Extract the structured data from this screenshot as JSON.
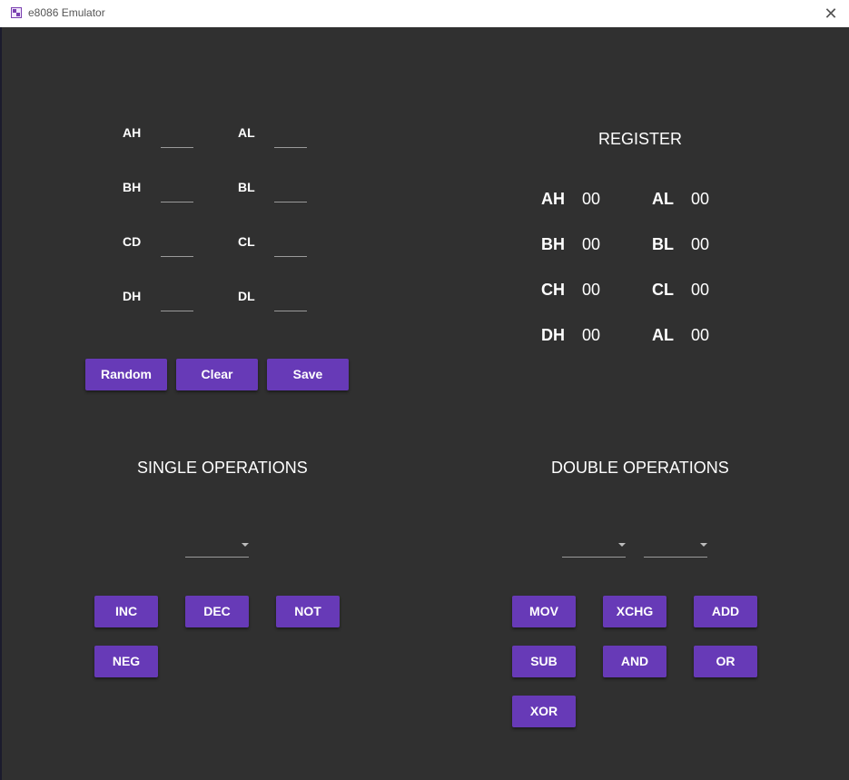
{
  "window": {
    "title": "e8086 Emulator",
    "app_icon": "app-icon",
    "close_icon": "close-icon",
    "close_glyph": "✕"
  },
  "inputs": {
    "AH": {
      "label": "AH",
      "value": ""
    },
    "AL": {
      "label": "AL",
      "value": ""
    },
    "BH": {
      "label": "BH",
      "value": ""
    },
    "BL": {
      "label": "BL",
      "value": ""
    },
    "CD": {
      "label": "CD",
      "value": ""
    },
    "CL": {
      "label": "CL",
      "value": ""
    },
    "DH": {
      "label": "DH",
      "value": ""
    },
    "DL": {
      "label": "DL",
      "value": ""
    }
  },
  "actions": {
    "random": "Random",
    "clear": "Clear",
    "save": "Save"
  },
  "register": {
    "heading": "REGISTER",
    "rows": [
      {
        "left_label": "AH",
        "left_value": "00",
        "right_label": "AL",
        "right_value": "00"
      },
      {
        "left_label": "BH",
        "left_value": "00",
        "right_label": "BL",
        "right_value": "00"
      },
      {
        "left_label": "CH",
        "left_value": "00",
        "right_label": "CL",
        "right_value": "00"
      },
      {
        "left_label": "DH",
        "left_value": "00",
        "right_label": "AL",
        "right_value": "00"
      }
    ]
  },
  "single_ops": {
    "heading": "SINGLE OPERATIONS",
    "selected": "",
    "buttons": [
      "INC",
      "DEC",
      "NOT",
      "NEG"
    ]
  },
  "double_ops": {
    "heading": "DOUBLE OPERATIONS",
    "selected_left": "",
    "selected_right": "",
    "buttons": [
      "MOV",
      "XCHG",
      "ADD",
      "SUB",
      "AND",
      "OR",
      "XOR"
    ]
  },
  "colors": {
    "background": "#303030",
    "accent": "#673ab7",
    "titlebar": "#ffffff"
  }
}
